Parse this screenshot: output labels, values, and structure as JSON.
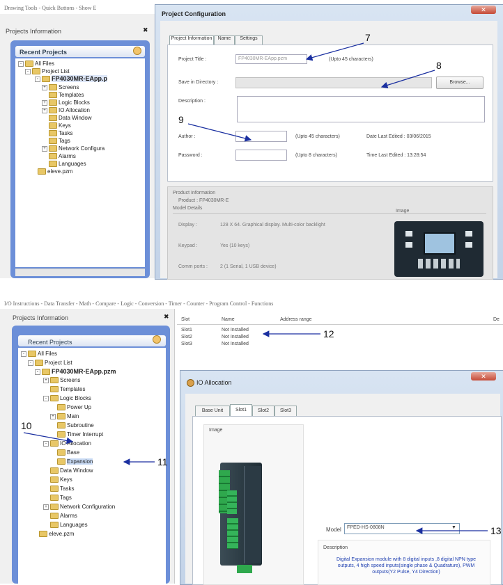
{
  "top": {
    "menu": "Drawing Tools - Quick Buttons - Show E",
    "panel_title": "Projects Information",
    "recent_projects": "Recent Projects",
    "tree": {
      "all_files": "All Files",
      "project_list": "Project List",
      "project": "FP4030MR-EApp.p",
      "items": [
        "Screens",
        "Templates",
        "Logic Blocks",
        "IO Allocation",
        "Data Window",
        "Keys",
        "Tasks",
        "Tags",
        "Network Configura",
        "Alarms",
        "Languages"
      ],
      "eleve": "eleve.pzm"
    },
    "dialog": {
      "title": "Project Configuration",
      "tabs": [
        "Project Information",
        "Name",
        "Settings"
      ],
      "project_title_label": "Project Title :",
      "project_title_value": "FP4030MR-EApp.pzm",
      "upto45": "(Upto 45 characters)",
      "save_dir_label": "Save in Directory :",
      "browse": "Browse...",
      "description_label": "Description :",
      "author_label": "Author :",
      "author_upto": "(Upto 45 characters)",
      "date_last_edited": "Date Last Edited :  03/06/2015",
      "password_label": "Password :",
      "password_upto": "(Upto 8 characters)",
      "time_last_edited": "Time Last Edited :  13:28:54",
      "product_info": "Product Information",
      "product": "Product :     FP4030MR-E",
      "model_details": "Model Details",
      "image_label": "Image",
      "display_label": "Display :",
      "display_value": "128 X 64. Graphical display. Multi-color backlight",
      "keypad_label": "Keypad :",
      "keypad_value": "Yes (10 keys)",
      "comm_label": "Comm ports :",
      "comm_value": "2 (1 Serial, 1 USB device)"
    }
  },
  "bottom": {
    "menu": "I/O Instructions - Data Transfer - Math - Compare - Logic - Conversion - Timer - Counter - Program Control - Functions",
    "panel_title": "Projects Information",
    "recent_projects": "Recent Projects",
    "tree": {
      "all_files": "All Files",
      "project_list": "Project List",
      "project": "FP4030MR-EApp.pzm",
      "screens": "Screens",
      "templates": "Templates",
      "logic_blocks": "Logic Blocks",
      "power_up": "Power Up",
      "main": "Main",
      "subroutine": "Subroutine",
      "timer_interrupt": "Timer Interrupt",
      "io_allocation": "IO Allocation",
      "base": "Base",
      "expansion": "Expansion",
      "data_window": "Data Window",
      "keys": "Keys",
      "tasks": "Tasks",
      "tags": "Tags",
      "network": "Network Configuration",
      "alarms": "Alarms",
      "languages": "Languages",
      "eleve": "eleve.pzm"
    },
    "table": {
      "headers": [
        "Slot",
        "Name",
        "Address range",
        "De"
      ],
      "rows": [
        [
          "Slot1",
          "Not Installed"
        ],
        [
          "Slot2",
          "Not Installed"
        ],
        [
          "Slot3",
          "Not Installed"
        ]
      ]
    },
    "dialog": {
      "title": "IO Allocation",
      "tabs": [
        "Base Unit",
        "Slot1",
        "Slot2",
        "Slot3"
      ],
      "image_label": "Image",
      "model_label": "Model",
      "model_value": "FPED-HS-0808N",
      "description_label": "Description",
      "description_text": "Digital Expansion module with 8 digital inputs ,8 digital NPN type outputs, 4 high speed inputs(single phase & Quadrature), PWM outputs(Y2 Pulse, Y4 Direction)"
    }
  },
  "callouts": [
    "7",
    "8",
    "9",
    "10",
    "11",
    "12",
    "13"
  ],
  "close_glyph": "✕",
  "pin_glyph": "✖"
}
